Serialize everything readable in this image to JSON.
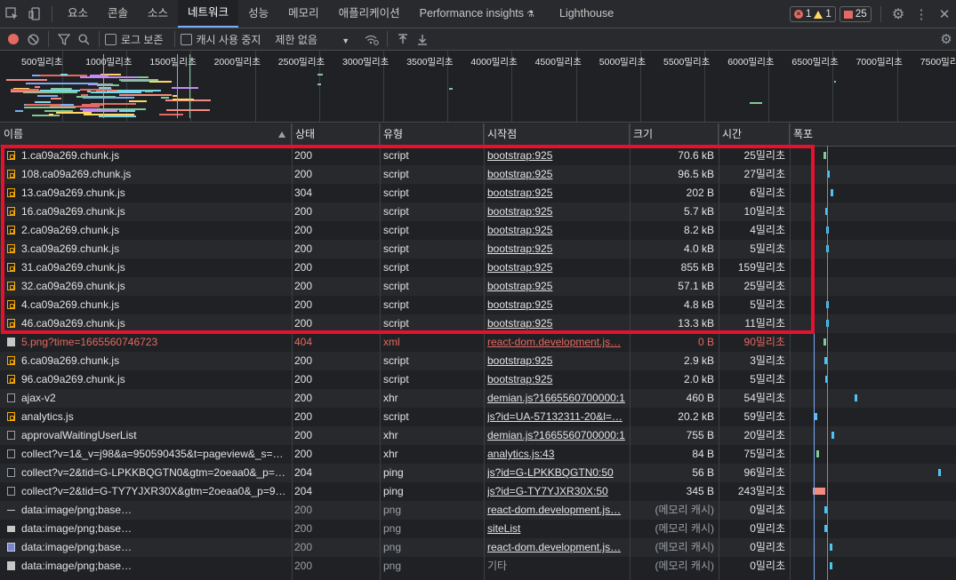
{
  "tabs": [
    "요소",
    "콘솔",
    "소스",
    "네트워크",
    "성능",
    "메모리",
    "애플리케이션",
    "Performance insights",
    "Lighthouse"
  ],
  "active_tab": "네트워크",
  "badges": {
    "errors": "1",
    "warnings": "1",
    "issues": "25"
  },
  "toolbar": {
    "preserve_log": "로그 보존",
    "disable_cache": "캐시 사용 중지",
    "throttling": "제한 없음"
  },
  "overview_ticks": [
    "500밀리초",
    "1000밀리초",
    "1500밀리초",
    "2000밀리초",
    "2500밀리초",
    "3000밀리초",
    "3500밀리초",
    "4000밀리초",
    "4500밀리초",
    "5000밀리초",
    "5500밀리초",
    "6000밀리초",
    "6500밀리초",
    "7000밀리초",
    "7500밀리초"
  ],
  "columns": {
    "name": "이름",
    "status": "상태",
    "type": "유형",
    "initiator": "시작점",
    "size": "크기",
    "time": "시간",
    "waterfall": "폭포"
  },
  "requests": [
    {
      "name": "1.ca09a269.chunk.js",
      "status": "200",
      "type": "script",
      "initiator": "bootstrap:925",
      "size": "70.6 kB",
      "time": "25밀리초",
      "icon": "script-icon"
    },
    {
      "name": "108.ca09a269.chunk.js",
      "status": "200",
      "type": "script",
      "initiator": "bootstrap:925",
      "size": "96.5 kB",
      "time": "27밀리초",
      "icon": "script-icon"
    },
    {
      "name": "13.ca09a269.chunk.js",
      "status": "304",
      "type": "script",
      "initiator": "bootstrap:925",
      "size": "202 B",
      "time": "6밀리초",
      "icon": "script-icon"
    },
    {
      "name": "16.ca09a269.chunk.js",
      "status": "200",
      "type": "script",
      "initiator": "bootstrap:925",
      "size": "5.7 kB",
      "time": "10밀리초",
      "icon": "script-icon"
    },
    {
      "name": "2.ca09a269.chunk.js",
      "status": "200",
      "type": "script",
      "initiator": "bootstrap:925",
      "size": "8.2 kB",
      "time": "4밀리초",
      "icon": "script-icon"
    },
    {
      "name": "3.ca09a269.chunk.js",
      "status": "200",
      "type": "script",
      "initiator": "bootstrap:925",
      "size": "4.0 kB",
      "time": "5밀리초",
      "icon": "script-icon"
    },
    {
      "name": "31.ca09a269.chunk.js",
      "status": "200",
      "type": "script",
      "initiator": "bootstrap:925",
      "size": "855 kB",
      "time": "159밀리초",
      "icon": "script-icon"
    },
    {
      "name": "32.ca09a269.chunk.js",
      "status": "200",
      "type": "script",
      "initiator": "bootstrap:925",
      "size": "57.1 kB",
      "time": "25밀리초",
      "icon": "script-icon"
    },
    {
      "name": "4.ca09a269.chunk.js",
      "status": "200",
      "type": "script",
      "initiator": "bootstrap:925",
      "size": "4.8 kB",
      "time": "5밀리초",
      "icon": "script-icon"
    },
    {
      "name": "46.ca09a269.chunk.js",
      "status": "200",
      "type": "script",
      "initiator": "bootstrap:925",
      "size": "13.3 kB",
      "time": "11밀리초",
      "icon": "script-icon"
    },
    {
      "name": "5.png?time=1665560746723",
      "status": "404",
      "type": "xml",
      "initiator": "react-dom.development.js…",
      "size": "0 B",
      "time": "90밀리초",
      "icon": "xml-file-icon",
      "error": true
    },
    {
      "name": "6.ca09a269.chunk.js",
      "status": "200",
      "type": "script",
      "initiator": "bootstrap:925",
      "size": "2.9 kB",
      "time": "3밀리초",
      "icon": "script-icon"
    },
    {
      "name": "96.ca09a269.chunk.js",
      "status": "200",
      "type": "script",
      "initiator": "bootstrap:925",
      "size": "2.0 kB",
      "time": "5밀리초",
      "icon": "script-icon"
    },
    {
      "name": "ajax-v2",
      "status": "200",
      "type": "xhr",
      "initiator": "demian.js?1665560700000:1",
      "size": "460 B",
      "time": "54밀리초",
      "icon": "document-icon"
    },
    {
      "name": "analytics.js",
      "status": "200",
      "type": "script",
      "initiator": "js?id=UA-57132311-20&l=…",
      "size": "20.2 kB",
      "time": "59밀리초",
      "icon": "script-icon"
    },
    {
      "name": "approvalWaitingUserList",
      "status": "200",
      "type": "xhr",
      "initiator": "demian.js?1665560700000:1",
      "size": "755 B",
      "time": "20밀리초",
      "icon": "document-icon"
    },
    {
      "name": "collect?v=1&_v=j98&a=950590435&t=pageview&_s=…",
      "status": "200",
      "type": "xhr",
      "initiator": "analytics.js:43",
      "size": "84 B",
      "time": "75밀리초",
      "icon": "document-icon"
    },
    {
      "name": "collect?v=2&tid=G-LPKKBQGTN0&gtm=2oeaa0&_p=…",
      "status": "204",
      "type": "ping",
      "initiator": "js?id=G-LPKKBQGTN0:50",
      "size": "56 B",
      "time": "96밀리초",
      "icon": "document-icon"
    },
    {
      "name": "collect?v=2&tid=G-TY7YJXR30X&gtm=2oeaa0&_p=9…",
      "status": "204",
      "type": "ping",
      "initiator": "js?id=G-TY7YJXR30X:50",
      "size": "345 B",
      "time": "243밀리초",
      "icon": "document-icon"
    },
    {
      "name": "data:image/png;base…",
      "status": "200",
      "type": "png",
      "initiator": "react-dom.development.js…",
      "size": "(메모리 캐시)",
      "time": "0밀리초",
      "icon": "dash-image-icon",
      "cached": true
    },
    {
      "name": "data:image/png;base…",
      "status": "200",
      "type": "png",
      "initiator": "siteList",
      "size": "(메모리 캐시)",
      "time": "0밀리초",
      "icon": "envelope-image-icon",
      "cached": true
    },
    {
      "name": "data:image/png;base…",
      "status": "200",
      "type": "png",
      "initiator": "react-dom.development.js…",
      "size": "(메모리 캐시)",
      "time": "0밀리초",
      "icon": "picture-image-icon",
      "cached": true
    },
    {
      "name": "data:image/png;base…",
      "status": "200",
      "type": "png",
      "initiator": "기타",
      "size": "(메모리 캐시)",
      "time": "0밀리초",
      "icon": "info-image-icon",
      "cached": true,
      "initiator_plain": true
    }
  ],
  "colors": {
    "error": "#e46962",
    "accent": "#7cacf8",
    "highlight": "#e8112d"
  }
}
